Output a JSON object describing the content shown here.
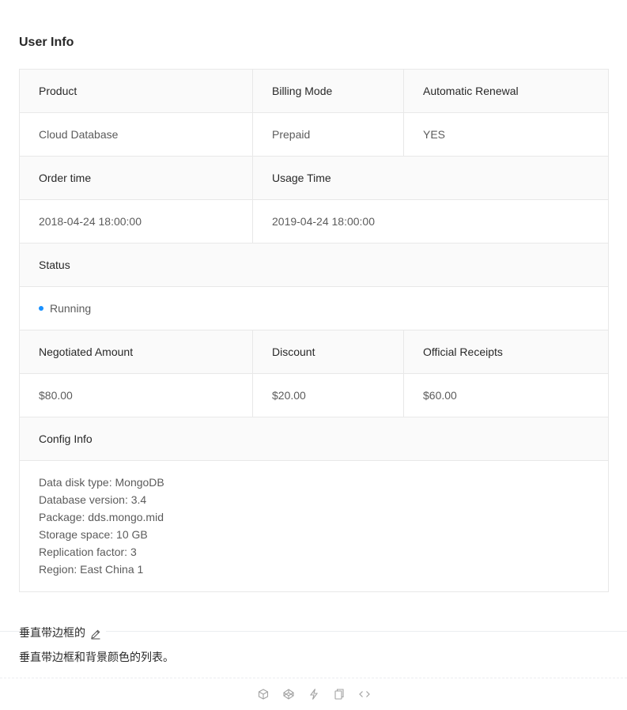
{
  "title": "User Info",
  "rows": {
    "r1": {
      "product_label": "Product",
      "billing_label": "Billing Mode",
      "renewal_label": "Automatic Renewal"
    },
    "r1v": {
      "product": "Cloud Database",
      "billing": "Prepaid",
      "renewal": "YES"
    },
    "r2": {
      "order_label": "Order time",
      "usage_label": "Usage Time"
    },
    "r2v": {
      "order": "2018-04-24 18:00:00",
      "usage": "2019-04-24 18:00:00"
    },
    "r3": {
      "status_label": "Status"
    },
    "r3v": {
      "status": "Running",
      "status_color": "#1890ff"
    },
    "r4": {
      "negotiated_label": "Negotiated Amount",
      "discount_label": "Discount",
      "receipts_label": "Official Receipts"
    },
    "r4v": {
      "negotiated": "$80.00",
      "discount": "$20.00",
      "receipts": "$60.00"
    },
    "r5": {
      "config_label": "Config Info"
    },
    "config_lines": [
      "Data disk type: MongoDB",
      "Database version: 3.4",
      "Package: dds.mongo.mid",
      "Storage space: 10 GB",
      "Replication factor: 3",
      "Region: East China 1"
    ]
  },
  "demo": {
    "title": "垂直带边框的",
    "description": "垂直带边框和背景颜色的列表。",
    "edit_icon": "edit-icon"
  },
  "actions": [
    "codesandbox-icon",
    "codepen-icon",
    "riddle-icon",
    "copy-icon",
    "code-expand-icon"
  ]
}
